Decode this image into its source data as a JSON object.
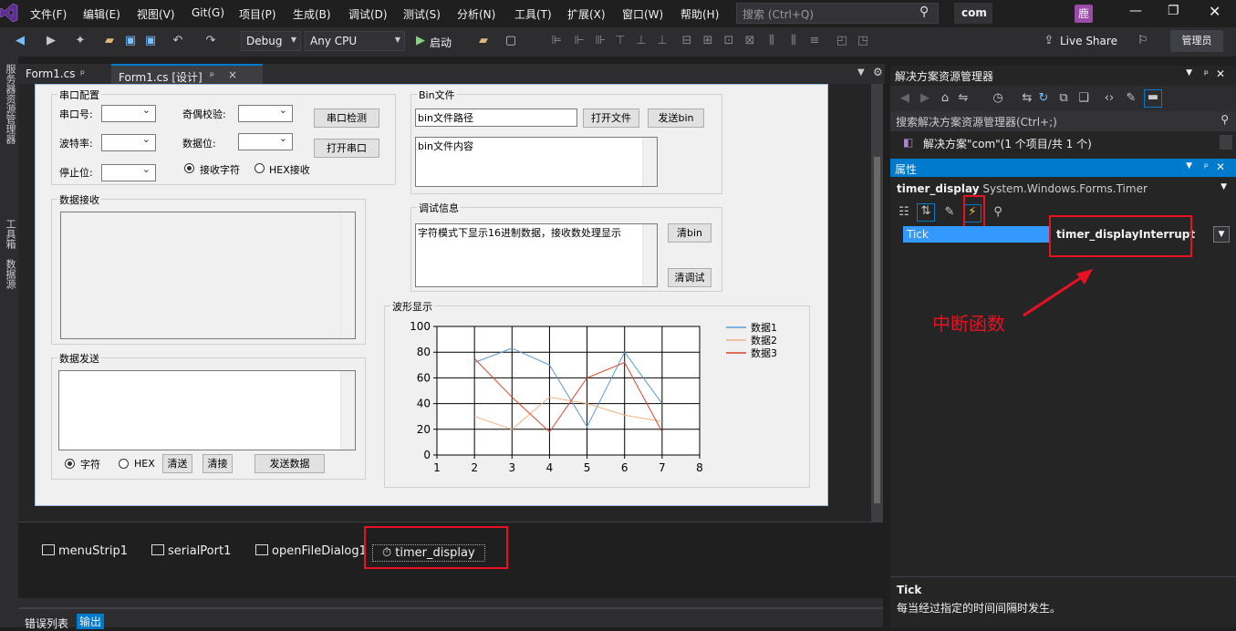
{
  "menu": [
    "文件(F)",
    "编辑(E)",
    "视图(V)",
    "Git(G)",
    "项目(P)",
    "生成(B)",
    "调试(D)",
    "测试(S)",
    "分析(N)",
    "工具(T)",
    "扩展(X)",
    "窗口(W)",
    "帮助(H)"
  ],
  "search_placeholder": "搜索 (Ctrl+Q)",
  "solution_badge": "com",
  "user_avatar": "鹿",
  "toolbar": {
    "config": "Debug",
    "platform": "Any CPU",
    "start": "启动",
    "live_share": "Live Share",
    "admin": "管理员"
  },
  "left_strip": [
    "服务器资源管理器",
    "工具箱",
    "数据源"
  ],
  "tabs": [
    {
      "label": "Form1.cs",
      "pin": "ᵖ"
    },
    {
      "label": "Form1.cs [设计]",
      "pin": "ᵖ",
      "close": "×"
    }
  ],
  "form": {
    "serial_group": "串口配置",
    "port_label": "串口号:",
    "parity_label": "奇偶校验:",
    "detect_btn": "串口检测",
    "baud_label": "波特率:",
    "databits_label": "数据位:",
    "open_btn": "打开串口",
    "stopbits_label": "停止位:",
    "recv_char": "接收字符",
    "recv_hex": "HEX接收",
    "bin_group": "Bin文件",
    "bin_path": "bin文件路径",
    "open_file_btn": "打开文件",
    "send_bin_btn": "发送bin",
    "bin_content": "bin文件内容",
    "recv_group": "数据接收",
    "debug_group": "调试信息",
    "debug_text": "字符模式下显示16进制数据，接收数处理显示",
    "clear_bin_btn": "清bin",
    "clear_debug_btn": "清调试",
    "send_group": "数据发送",
    "send_char": "字符",
    "send_hex": "HEX",
    "clear_send_btn": "清送",
    "clear_recv_btn": "清接",
    "send_data_btn": "发送数据",
    "wave_group": "波形显示"
  },
  "chart_data": {
    "type": "line",
    "title": "",
    "x": [
      1,
      2,
      3,
      4,
      5,
      6,
      7,
      8
    ],
    "xlim": [
      1,
      8
    ],
    "ylim": [
      0,
      100
    ],
    "xticks": [
      "1",
      "2",
      "3",
      "4",
      "5",
      "6",
      "7",
      "8"
    ],
    "yticks": [
      "0",
      "20",
      "40",
      "60",
      "80",
      "100"
    ],
    "grid": true,
    "legend_position": "top-right",
    "series": [
      {
        "name": "数据1",
        "color": "#5b9bd5",
        "x": [
          2,
          3,
          4,
          5,
          6,
          7
        ],
        "values": [
          72,
          83,
          70,
          22,
          80,
          40
        ]
      },
      {
        "name": "数据2",
        "color": "#f4b183",
        "x": [
          2,
          3,
          4,
          5,
          6,
          7
        ],
        "values": [
          30,
          20,
          45,
          40,
          31,
          26
        ]
      },
      {
        "name": "数据3",
        "color": "#d9472b",
        "x": [
          2,
          3,
          4,
          5,
          6,
          7
        ],
        "values": [
          75,
          45,
          18,
          60,
          72,
          18
        ]
      }
    ]
  },
  "tray": [
    "menuStrip1",
    "serialPort1",
    "openFileDialog1",
    "timer_display"
  ],
  "bottom_tabs": [
    "错误列表",
    "输出"
  ],
  "solution_explorer": {
    "title": "解决方案资源管理器",
    "search": "搜索解决方案资源管理器(Ctrl+;)",
    "node": "解决方案\"com\"(1 个项目/共 1 个)"
  },
  "properties": {
    "title": "属性",
    "object": "timer_display",
    "type": "System.Windows.Forms.Timer",
    "event_name": "Tick",
    "event_value": "timer_displayInterrupt",
    "desc_title": "Tick",
    "desc_text": "每当经过指定的时间间隔时发生。"
  },
  "annotation": "中断函数"
}
